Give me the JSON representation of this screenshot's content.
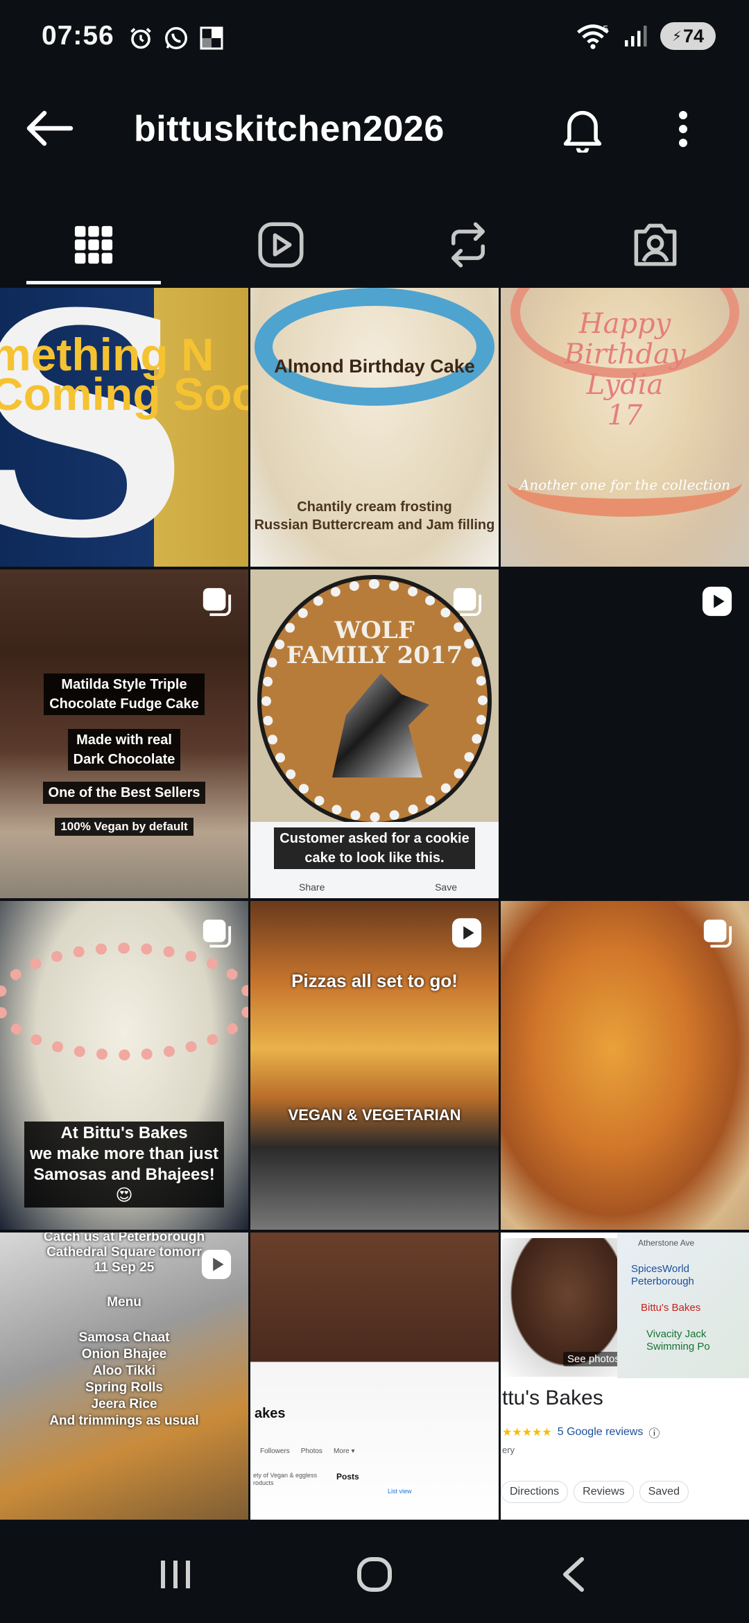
{
  "status_bar": {
    "time": "07:56",
    "battery": "74",
    "icons_left": [
      "alarm-icon",
      "whatsapp-icon",
      "nyt-icon"
    ],
    "icons_right": [
      "wifi-icon",
      "signal-icon",
      "battery-icon"
    ]
  },
  "header": {
    "username": "bittuskitchen2026",
    "back_icon": "arrow-left-icon",
    "bell_icon": "bell-icon",
    "more_icon": "more-vertical-icon"
  },
  "tabs": [
    {
      "name": "posts",
      "icon": "grid-icon",
      "active": true
    },
    {
      "name": "reels",
      "icon": "reels-icon",
      "active": false
    },
    {
      "name": "reposts",
      "icon": "repost-icon",
      "active": false
    },
    {
      "name": "tagged",
      "icon": "tagged-icon",
      "active": false
    }
  ],
  "posts": [
    {
      "type": "image",
      "lines": [
        "mething N",
        "Coming Soo"
      ]
    },
    {
      "type": "image",
      "title": "Almond Birthday Cake",
      "sub1": "Chantily cream frosting",
      "sub2": "Russian Buttercream and Jam filling"
    },
    {
      "type": "image",
      "script": "Happy\nBirthday\nLydia\n17",
      "sub": "Another one for the collection"
    },
    {
      "type": "carousel",
      "captions": [
        "Matilda Style Triple\nChocolate Fudge Cake",
        "Made with real\nDark Chocolate",
        "One of the Best Sellers",
        "100% Vegan by default"
      ]
    },
    {
      "type": "carousel",
      "wolf": "WOLF\nFAMILY 2017",
      "caption": "Customer asked for a cookie\ncake to look like this.",
      "share": "Share",
      "save": "Save"
    },
    {
      "type": "reel"
    },
    {
      "type": "carousel",
      "caption": "At Bittu's Bakes\nwe make more than just\nSamosas and Bhajees!\n😍"
    },
    {
      "type": "reel",
      "caption1": "Pizzas all set to go!",
      "caption2": "VEGAN & VEGETARIAN"
    },
    {
      "type": "carousel"
    },
    {
      "type": "reel",
      "caption": "Catch us at Peterborough\nCathedral Square tomorr\n11 Sep 25",
      "menu_title": "Menu",
      "menu": "Samosa Chaat\nOnion Bhajee\nAloo Tikki\nSpring Rolls\nJeera Rice\nAnd trimmings as usual"
    },
    {
      "type": "image",
      "page": "akes",
      "tabs": [
        "Followers",
        "Photos",
        "More ▾"
      ],
      "posts_label": "Posts",
      "list_view": "List view",
      "desc": "ety of Vegan & eggless\nroducts"
    },
    {
      "type": "image",
      "see_photos": "See photos",
      "business": "ttu's Bakes",
      "stars": "★★★★★",
      "reviews": "5 Google reviews",
      "category": "ery",
      "map_labels": [
        "Atherstone Ave",
        "SpicesWorld\nPeterborough",
        "Bittu's Bakes",
        "Vivacity Jack\nSwimming Po"
      ],
      "actions": [
        "Directions",
        "Reviews",
        "Saved"
      ]
    }
  ],
  "nav": [
    "recents-icon",
    "home-icon",
    "back-icon"
  ]
}
